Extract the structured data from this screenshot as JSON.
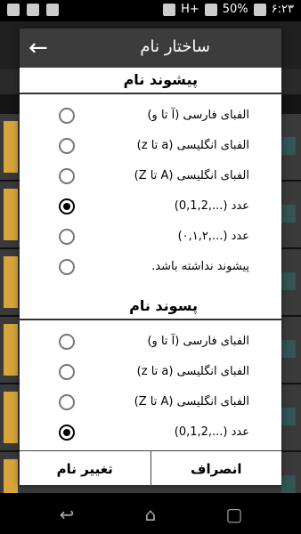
{
  "statusbar": {
    "time": "۶:۲۳",
    "battery": "50%",
    "network": "H+"
  },
  "dialog": {
    "title": "ساختار نام",
    "prefix": {
      "title": "پیشوند نام",
      "options": [
        {
          "label": "الفبای فارسی (آ تا و)",
          "checked": false
        },
        {
          "label": "الفبای انگلیسی (a تا z)",
          "checked": false
        },
        {
          "label": "الفبای انگلیسی (A تا Z)",
          "checked": false
        },
        {
          "label": "عدد (...,0,1,2)",
          "checked": true
        },
        {
          "label": "عدد (...,۰,۱,۲)",
          "checked": false
        },
        {
          "label": "پیشوند نداشته باشد.",
          "checked": false
        }
      ]
    },
    "suffix": {
      "title": "پسوند نام",
      "options": [
        {
          "label": "الفبای فارسی (آ تا و)",
          "checked": false
        },
        {
          "label": "الفبای انگلیسی (a تا z)",
          "checked": false
        },
        {
          "label": "الفبای انگلیسی (A تا Z)",
          "checked": false
        },
        {
          "label": "عدد (...,0,1,2)",
          "checked": true
        }
      ]
    },
    "footer": {
      "rename_label": "تغییر نام",
      "cancel_label": "انصراف"
    }
  }
}
